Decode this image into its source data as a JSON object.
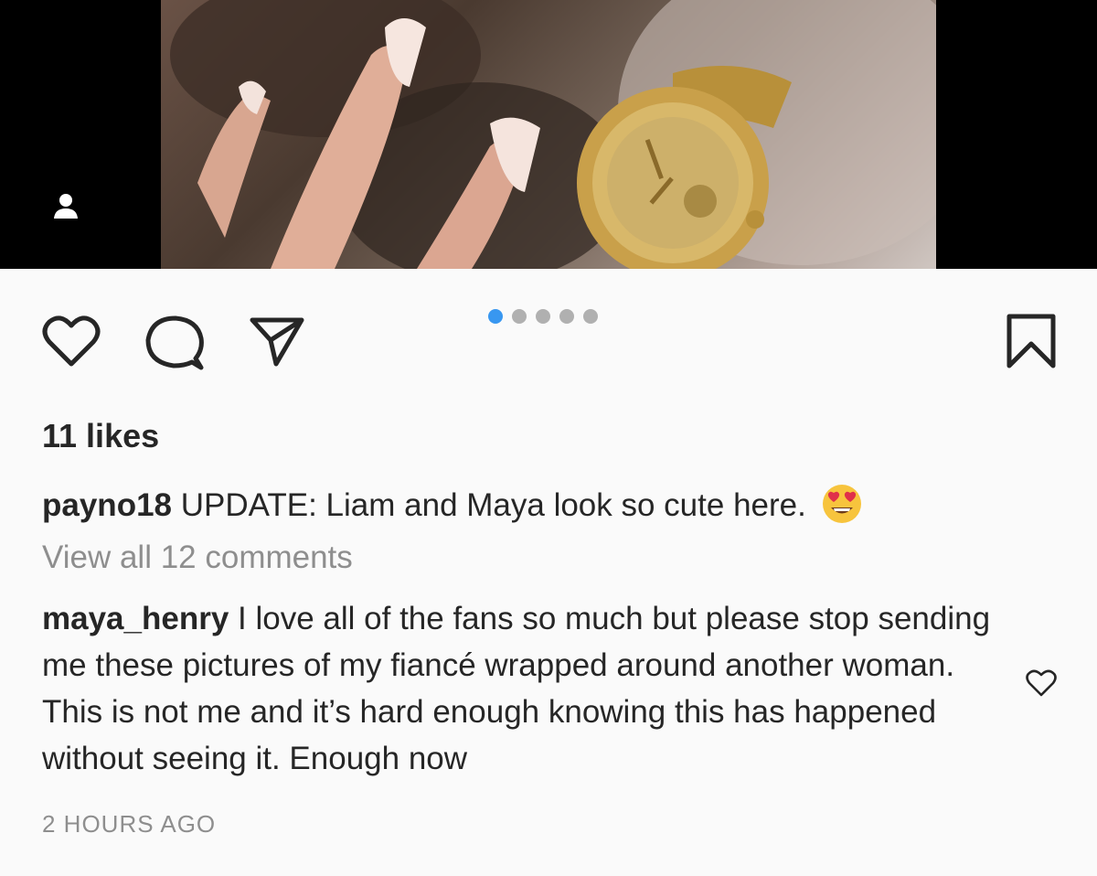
{
  "post": {
    "carousel": {
      "total": 5,
      "active_index": 0,
      "active_color": "#3897f0",
      "inactive_color": "#b0b0b0"
    },
    "icons": {
      "like": "heart-icon",
      "comment": "comment-bubble-icon",
      "share": "paper-plane-icon",
      "save": "bookmark-icon",
      "tag": "user-tag-icon"
    },
    "likes_text": "11 likes",
    "caption": {
      "username": "payno18",
      "text": "UPDATE: Liam and Maya look so cute here.",
      "emoji": "heart-eyes-emoji"
    },
    "view_all_comments": "View all 12 comments",
    "comment": {
      "username": "maya_henry",
      "text": "I love all of the fans so much but please stop sending me these pictures of my fiancé wrapped around another woman. This is not me and it’s hard enough knowing this has happened without seeing it. Enough now"
    },
    "timestamp": "2 HOURS AGO"
  }
}
